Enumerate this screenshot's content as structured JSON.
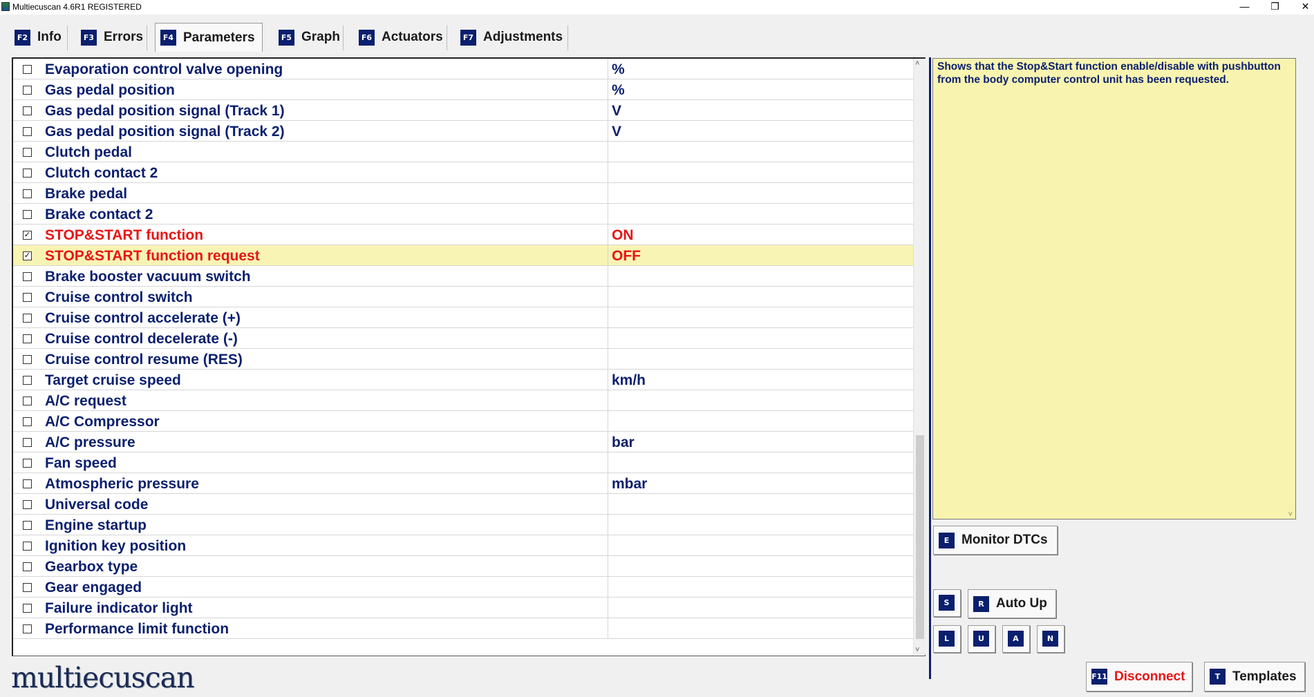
{
  "window": {
    "title": "Multiecuscan 4.6R1 REGISTERED",
    "minimize_glyph": "—",
    "restore_glyph": "❐",
    "close_glyph": "✕"
  },
  "tabs": [
    {
      "key": "F2",
      "label": "Info",
      "active": false
    },
    {
      "key": "F3",
      "label": "Errors",
      "active": false
    },
    {
      "key": "F4",
      "label": "Parameters",
      "active": true
    },
    {
      "key": "F5",
      "label": "Graph",
      "active": false
    },
    {
      "key": "F6",
      "label": "Actuators",
      "active": false
    },
    {
      "key": "F7",
      "label": "Adjustments",
      "active": false
    }
  ],
  "parameters": [
    {
      "name": "Evaporation control valve opening",
      "value": "%",
      "checked": false,
      "highlight": false,
      "selected": false
    },
    {
      "name": "Gas pedal position",
      "value": "%",
      "checked": false,
      "highlight": false,
      "selected": false
    },
    {
      "name": "Gas pedal position signal (Track 1)",
      "value": "V",
      "checked": false,
      "highlight": false,
      "selected": false
    },
    {
      "name": "Gas pedal position signal (Track 2)",
      "value": "V",
      "checked": false,
      "highlight": false,
      "selected": false
    },
    {
      "name": "Clutch pedal",
      "value": "",
      "checked": false,
      "highlight": false,
      "selected": false
    },
    {
      "name": "Clutch contact 2",
      "value": "",
      "checked": false,
      "highlight": false,
      "selected": false
    },
    {
      "name": "Brake pedal",
      "value": "",
      "checked": false,
      "highlight": false,
      "selected": false
    },
    {
      "name": "Brake contact 2",
      "value": "",
      "checked": false,
      "highlight": false,
      "selected": false
    },
    {
      "name": "STOP&START function",
      "value": "ON",
      "checked": true,
      "highlight": true,
      "selected": false
    },
    {
      "name": "STOP&START function request",
      "value": "OFF",
      "checked": true,
      "highlight": true,
      "selected": true
    },
    {
      "name": "Brake booster vacuum switch",
      "value": "",
      "checked": false,
      "highlight": false,
      "selected": false
    },
    {
      "name": "Cruise control switch",
      "value": "",
      "checked": false,
      "highlight": false,
      "selected": false
    },
    {
      "name": "Cruise control accelerate (+)",
      "value": "",
      "checked": false,
      "highlight": false,
      "selected": false
    },
    {
      "name": "Cruise control decelerate (-)",
      "value": "",
      "checked": false,
      "highlight": false,
      "selected": false
    },
    {
      "name": "Cruise control resume (RES)",
      "value": "",
      "checked": false,
      "highlight": false,
      "selected": false
    },
    {
      "name": "Target cruise speed",
      "value": "km/h",
      "checked": false,
      "highlight": false,
      "selected": false
    },
    {
      "name": "A/C request",
      "value": "",
      "checked": false,
      "highlight": false,
      "selected": false
    },
    {
      "name": "A/C Compressor",
      "value": "",
      "checked": false,
      "highlight": false,
      "selected": false
    },
    {
      "name": "A/C pressure",
      "value": "bar",
      "checked": false,
      "highlight": false,
      "selected": false
    },
    {
      "name": "Fan speed",
      "value": "",
      "checked": false,
      "highlight": false,
      "selected": false
    },
    {
      "name": "Atmospheric pressure",
      "value": "mbar",
      "checked": false,
      "highlight": false,
      "selected": false
    },
    {
      "name": "Universal code",
      "value": "",
      "checked": false,
      "highlight": false,
      "selected": false
    },
    {
      "name": "Engine startup",
      "value": "",
      "checked": false,
      "highlight": false,
      "selected": false
    },
    {
      "name": "Ignition key position",
      "value": "",
      "checked": false,
      "highlight": false,
      "selected": false
    },
    {
      "name": "Gearbox type",
      "value": "",
      "checked": false,
      "highlight": false,
      "selected": false
    },
    {
      "name": "Gear engaged",
      "value": "",
      "checked": false,
      "highlight": false,
      "selected": false
    },
    {
      "name": "Failure indicator light",
      "value": "",
      "checked": false,
      "highlight": false,
      "selected": false
    },
    {
      "name": "Performance limit function",
      "value": "",
      "checked": false,
      "highlight": false,
      "selected": false
    }
  ],
  "checkbox_checked_glyph": "✓",
  "scroll": {
    "up_glyph": "˄",
    "down_glyph": "˅"
  },
  "description": {
    "text": "Shows that the Stop&Start function enable/disable with pushbutton from the body computer control unit has been requested."
  },
  "buttons": {
    "monitor_dtcs": {
      "key": "E",
      "label": "Monitor DTCs"
    },
    "s": {
      "key": "S"
    },
    "auto_up": {
      "key": "R",
      "label": "Auto Up"
    },
    "l": {
      "key": "L"
    },
    "u": {
      "key": "U"
    },
    "a": {
      "key": "A"
    },
    "n": {
      "key": "N"
    },
    "disconnect": {
      "key": "F11",
      "label": "Disconnect"
    },
    "templates": {
      "key": "T",
      "label": "Templates"
    }
  },
  "logo": {
    "text": "multiecuscan"
  },
  "colors": {
    "navy": "#0a1f6e",
    "highlight_red": "#e81515",
    "selected_row": "#f8f4b4",
    "description_bg": "#f8f4b0"
  }
}
